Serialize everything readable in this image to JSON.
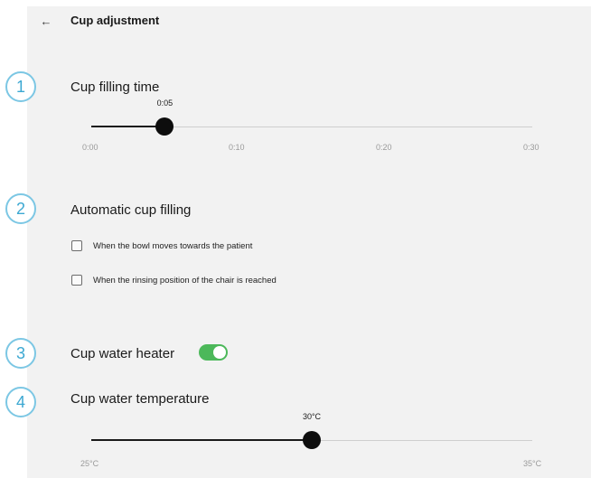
{
  "header": {
    "back_icon": "←",
    "title": "Cup adjustment"
  },
  "sections": [
    {
      "step": "1",
      "title": "Cup filling time",
      "slider": {
        "value_label": "0:05",
        "value": 5,
        "min": 0,
        "max": 30,
        "ticks": [
          "0:00",
          "0:10",
          "0:20",
          "0:30"
        ]
      }
    },
    {
      "step": "2",
      "title": "Automatic cup filling",
      "options": [
        {
          "label": "When the bowl moves towards the patient",
          "checked": false
        },
        {
          "label": "When the rinsing position of the chair is reached",
          "checked": false
        }
      ]
    },
    {
      "step": "3",
      "title": "Cup water heater",
      "toggle": {
        "on": true,
        "color": "#4cb85a"
      }
    },
    {
      "step": "4",
      "title": "Cup water temperature",
      "slider": {
        "value_label": "30°C",
        "value": 30,
        "min": 25,
        "max": 35,
        "ticks": [
          "25°C",
          "35°C"
        ]
      }
    }
  ],
  "colors": {
    "badge_border": "#7cc7e4",
    "badge_text": "#3ca8d2",
    "panel_background": "#f2f2f2",
    "thumb": "#0d0d0d"
  }
}
